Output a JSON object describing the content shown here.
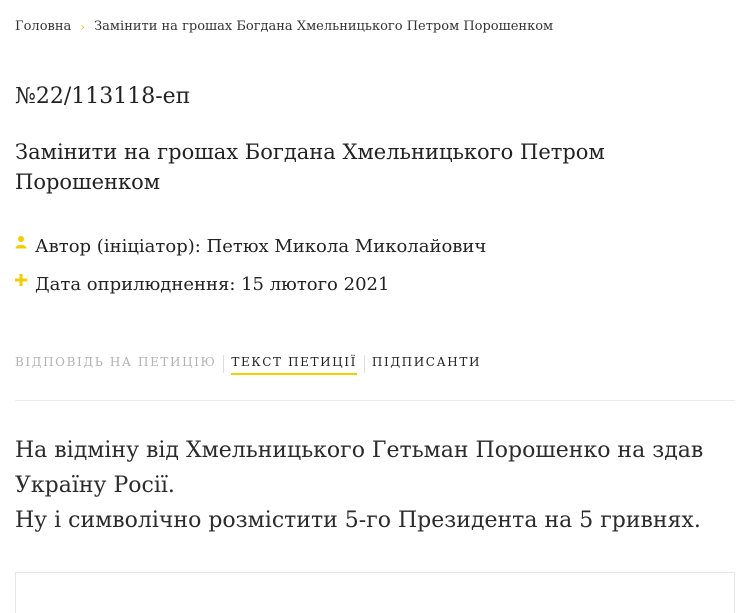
{
  "breadcrumb": {
    "home": "Головна",
    "separator": "›",
    "current": "Замінити на грошах Богдана Хмельницького Петром Порошенком"
  },
  "petition": {
    "number": "№22/113118-еп",
    "title": "Замінити на грошах Богдана Хмельницького Петром Порошенком",
    "author": "Автор (ініціатор): Петюх Микола Миколайович",
    "date": "Дата оприлюднення: 15 лютого 2021"
  },
  "tabs": [
    {
      "label": "Відповідь на петицію"
    },
    {
      "label": "Текст петиції"
    },
    {
      "label": "Підписанти"
    }
  ],
  "body": {
    "line1": "На відміну від Хмельницького Гетьман Порошенко на здав Україну Росії.",
    "line2": "Ну і символічно розмістити 5-го Президента на 5 гривнях."
  },
  "colors": {
    "accent": "#f2cf00",
    "muted": "#b3b3b3",
    "text": "#222222"
  },
  "icons": {
    "author": "user-icon",
    "date": "plus-icon",
    "breadcrumb": "chevron-right-icon"
  }
}
